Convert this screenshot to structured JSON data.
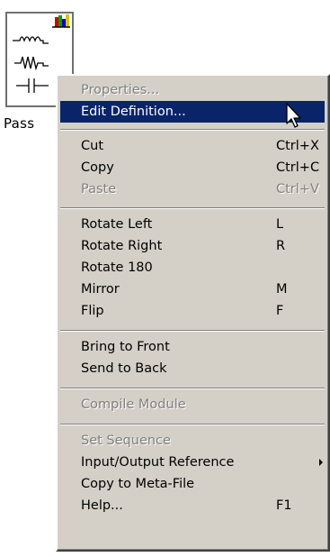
{
  "block": {
    "label": "Pass",
    "icon": "passive-elements-icon"
  },
  "menu": {
    "items": [
      {
        "label": "Properties...",
        "accel": "",
        "disabled": true
      },
      {
        "label": "Edit Definition...",
        "accel": "",
        "selected": true
      },
      {
        "label": "Cut",
        "accel": "Ctrl+X"
      },
      {
        "label": "Copy",
        "accel": "Ctrl+C"
      },
      {
        "label": "Paste",
        "accel": "Ctrl+V",
        "disabled": true
      },
      {
        "label": "Rotate Left",
        "accel": "L"
      },
      {
        "label": "Rotate Right",
        "accel": "R"
      },
      {
        "label": "Rotate 180",
        "accel": ""
      },
      {
        "label": "Mirror",
        "accel": "M"
      },
      {
        "label": "Flip",
        "accel": "F"
      },
      {
        "label": "Bring to Front",
        "accel": ""
      },
      {
        "label": "Send to Back",
        "accel": ""
      },
      {
        "label": "Compile Module",
        "accel": "",
        "disabled": true
      },
      {
        "label": "Set Sequence",
        "accel": "",
        "disabled": true
      },
      {
        "label": "Input/Output Reference",
        "accel": "",
        "submenu": true
      },
      {
        "label": "Copy to Meta-File",
        "accel": ""
      },
      {
        "label": "Help...",
        "accel": "F1"
      }
    ]
  },
  "colors": {
    "menu_bg": "#d4d0c8",
    "highlight": "#0a246a",
    "disabled_text": "#808080",
    "bar_red": "#d00000",
    "bar_green": "#00a000",
    "bar_blue": "#0000c0",
    "bar_yellow": "#e0c000"
  }
}
